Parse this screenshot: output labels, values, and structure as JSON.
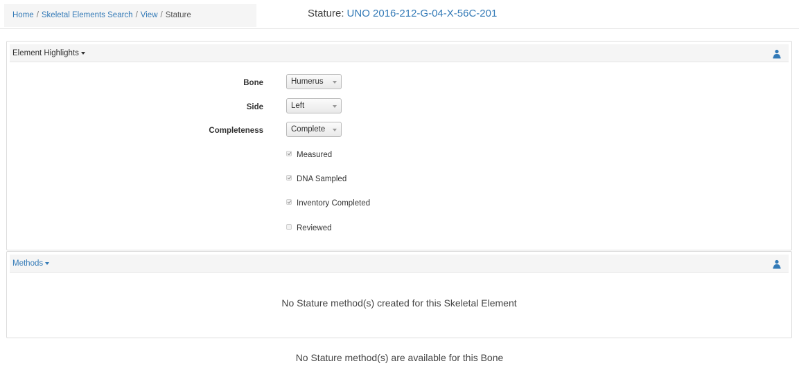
{
  "breadcrumb": {
    "items": [
      {
        "label": "Home"
      },
      {
        "label": "Skeletal Elements Search"
      },
      {
        "label": "View"
      }
    ],
    "current": "Stature",
    "separator": "/"
  },
  "header": {
    "title_prefix": "Stature:",
    "title_link": "UNO 2016-212-G-04-X-56C-201"
  },
  "element_highlights": {
    "heading": "Element Highlights",
    "fields": [
      {
        "label": "Bone",
        "value": "Humerus"
      },
      {
        "label": "Side",
        "value": "Left"
      },
      {
        "label": "Completeness",
        "value": "Complete"
      }
    ],
    "checkboxes": [
      {
        "label": "Measured",
        "checked": true
      },
      {
        "label": "DNA Sampled",
        "checked": true
      },
      {
        "label": "Inventory Completed",
        "checked": true
      },
      {
        "label": "Reviewed",
        "checked": false
      }
    ]
  },
  "methods": {
    "heading": "Methods",
    "empty_message": "No Stature method(s) created for this Skeletal Element"
  },
  "footer": {
    "message": "No Stature method(s) are available for this Bone"
  },
  "icons": {
    "panel_action": "user-icon"
  },
  "colors": {
    "link": "#337ab7",
    "panel_header_bg": "#f5f5f5"
  }
}
